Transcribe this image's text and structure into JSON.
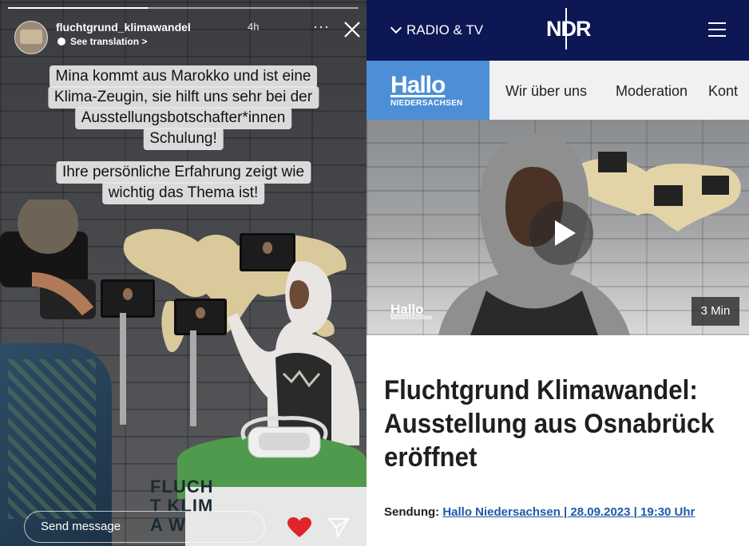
{
  "story": {
    "progress": 0.4,
    "account": "fluchtgrund_klimawandel",
    "time": "4h",
    "translation": "See translation >",
    "more": "···",
    "caption_lines": [
      "Mina kommt aus Marokko und ist eine",
      "Klima-Zeugin, sie hilft uns sehr bei der",
      "Ausstellungsbotschafter*innen",
      "Schulung!",
      "Ihre persönliche Erfahrung zeigt wie",
      "wichtig das Thema ist!"
    ],
    "send_placeholder": "Send message",
    "table_text": "FLUCHT KLIMA W"
  },
  "ndr": {
    "menu_label": "RADIO & TV",
    "logo": "NDR",
    "brand": {
      "main": "Hallo",
      "sub": "NIEDERSACHSEN"
    },
    "nav": [
      "Wir über uns",
      "Moderation",
      "Kont"
    ],
    "video": {
      "duration": "3 Min",
      "logo_main": "Hallo",
      "logo_sub": "NIEDERSACHSEN"
    },
    "headline": "Fluchtgrund Klimawandel: Ausstellung aus Osnabrück eröffnet",
    "sendung_label": "Sendung:",
    "sendung_link": "Hallo Niedersachsen | 28.09.2023 | 19:30 Uhr"
  },
  "colors": {
    "ndr_navy": "#0c1754",
    "hallo_blue": "#4d8fd6",
    "link_blue": "#1e5aa8",
    "heart_red": "#e1242b",
    "table_green": "#4f9a4c"
  }
}
